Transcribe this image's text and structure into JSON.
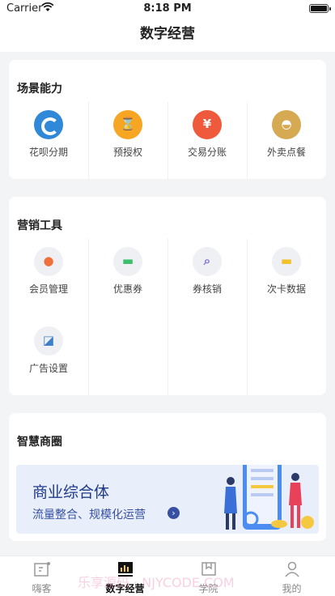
{
  "status": {
    "carrier": "Carrier",
    "time": "8:18 PM"
  },
  "nav": {
    "title": "数字经营"
  },
  "sections": {
    "scene": {
      "title": "场景能力",
      "items": [
        {
          "label": "花呗分期",
          "icon": "huabei-icon"
        },
        {
          "label": "预授权",
          "icon": "hourglass-icon"
        },
        {
          "label": "交易分账",
          "icon": "split-bill-icon"
        },
        {
          "label": "外卖点餐",
          "icon": "food-cover-icon"
        }
      ]
    },
    "marketing": {
      "title": "营销工具",
      "items": [
        {
          "label": "会员管理",
          "icon": "member-icon"
        },
        {
          "label": "优惠券",
          "icon": "coupon-icon"
        },
        {
          "label": "券核销",
          "icon": "coupon-verify-icon"
        },
        {
          "label": "次卡数据",
          "icon": "card-data-icon"
        },
        {
          "label": "广告设置",
          "icon": "ad-settings-icon"
        }
      ]
    },
    "circle": {
      "title": "智慧商圈",
      "banner": {
        "title": "商业综合体",
        "subtitle": "流量整合、规模化运营"
      }
    }
  },
  "tabbar": {
    "items": [
      {
        "label": "嗨客",
        "icon": "hike-icon"
      },
      {
        "label": "数字经营",
        "icon": "chart-icon",
        "active": true
      },
      {
        "label": "学院",
        "icon": "book-icon"
      },
      {
        "label": "我的",
        "icon": "profile-icon"
      }
    ]
  },
  "watermark": "乐享源码 · NJYCODE.COM",
  "colors": {
    "accent": "#1f3a8a",
    "huabei": "#2f89d8",
    "yushou": "#f6a623",
    "jiaoyi": "#ef5a3c",
    "waimai": "#d6aa52"
  }
}
